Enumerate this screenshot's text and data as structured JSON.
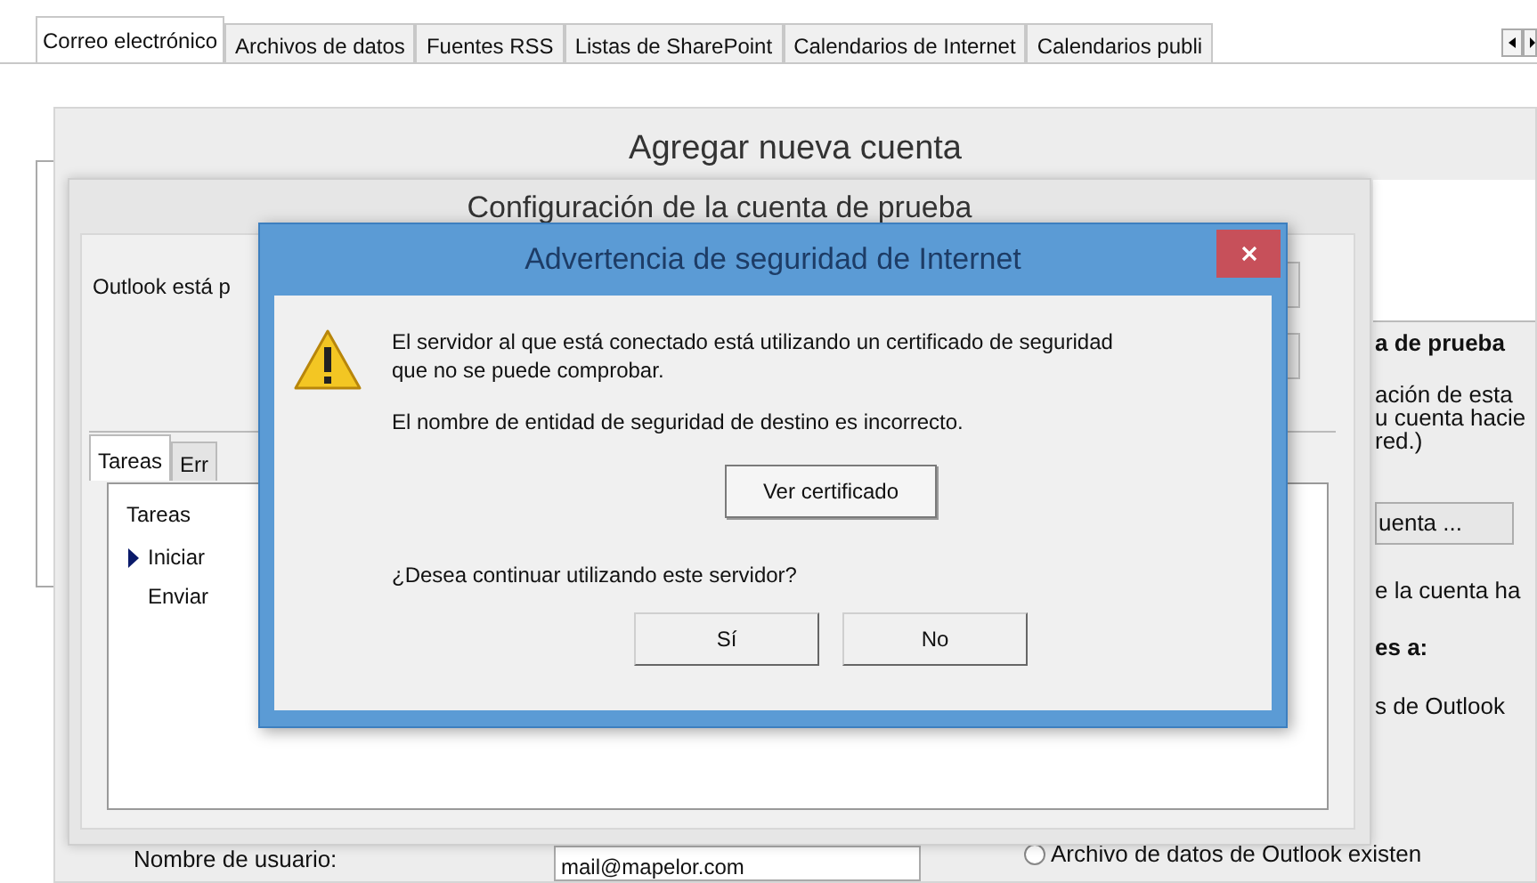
{
  "tabs": [
    {
      "label": "Correo electrónico",
      "selected": true
    },
    {
      "label": "Archivos de datos",
      "selected": false
    },
    {
      "label": "Fuentes RSS",
      "selected": false
    },
    {
      "label": "Listas de SharePoint",
      "selected": false
    },
    {
      "label": "Calendarios de Internet",
      "selected": false
    },
    {
      "label": "Calendarios publi",
      "selected": false
    }
  ],
  "add_account_window": {
    "title": "Agregar nueva cuenta",
    "right_panel": {
      "heading": "a de prueba",
      "lines": [
        "ación de esta",
        "u cuenta hacie",
        "red.)"
      ],
      "button": "uenta ...",
      "note": "e la cuenta ha",
      "section_heading": "es a:",
      "option": "s de Outlook"
    },
    "username": {
      "label": "Nombre de usuario:",
      "value": "mail@mapelor.com"
    },
    "radio_option": {
      "label": "Archivo de datos de Outlook existen",
      "selected": false
    }
  },
  "test_settings_window": {
    "title": "Configuración de la cuenta de prueba",
    "status_text": "Outlook está p",
    "inner_tabs": [
      {
        "label": "Tareas",
        "selected": true
      },
      {
        "label": "Err",
        "selected": false
      }
    ],
    "tasks": {
      "column": "Tareas",
      "rows": [
        {
          "label": "Iniciar",
          "current": true
        },
        {
          "label": "Enviar",
          "current": false
        }
      ]
    }
  },
  "security_dialog": {
    "title": "Advertencia de seguridad de Internet",
    "message": "El servidor al que está conectado está utilizando un certificado de seguridad que no se puede comprobar.",
    "detail": "El nombre de entidad de seguridad de destino es incorrecto.",
    "view_button": "Ver certificado",
    "question": "¿Desea continuar utilizando este servidor?",
    "buttons": [
      "Sí",
      "No"
    ]
  }
}
